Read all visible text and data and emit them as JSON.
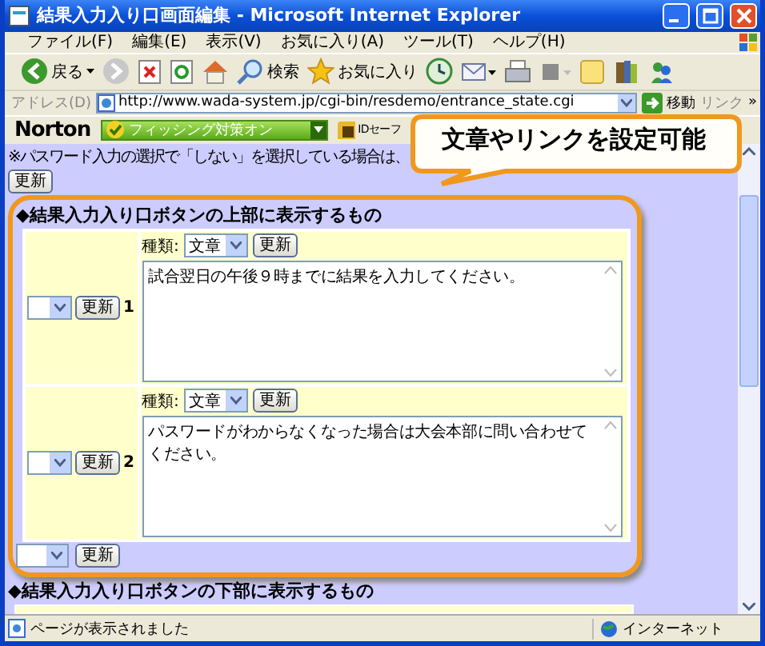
{
  "window": {
    "title": "結果入力入り口画面編集 - Microsoft Internet Explorer"
  },
  "menu": [
    "ファイル(F)",
    "編集(E)",
    "表示(V)",
    "お気に入り(A)",
    "ツール(T)",
    "ヘルプ(H)"
  ],
  "toolbar": {
    "back": "戻る",
    "search": "検索",
    "favorites": "お気に入り"
  },
  "address_bar": {
    "label": "アドレス(D)",
    "url": "http://www.wada-system.jp/cgi-bin/resdemo/entrance_state.cgi",
    "go": "移動",
    "links": "リンク",
    "more": "»"
  },
  "norton_bar": {
    "brand": "Norton",
    "phishing": "フィッシング対策オン",
    "id_safe": "IDセーフ"
  },
  "content": {
    "note": "※パスワード入力の選択で「しない」を選択している場合は、",
    "update_button": "更新",
    "sections": [
      {
        "heading": "◆結果入力入り口ボタンの上部に表示するもの",
        "rows": [
          {
            "update": "更新",
            "number": "1",
            "type_label": "種類:",
            "type": "文章",
            "type_update": "更新",
            "text": "試合翌日の午後９時までに結果を入力してください。"
          },
          {
            "update": "更新",
            "number": "2",
            "type_label": "種類:",
            "type": "文章",
            "type_update": "更新",
            "text": "パスワードがわからなくなった場合は大会本部に問い合わせてください。"
          }
        ],
        "footer_update": "更新"
      },
      {
        "heading": "◆結果入力入り口ボタンの下部に表示するもの"
      }
    ]
  },
  "callout": {
    "text": "文章やリンクを設定可能"
  },
  "status_bar": {
    "text": "ページが表示されました",
    "zone": "インターネット"
  }
}
